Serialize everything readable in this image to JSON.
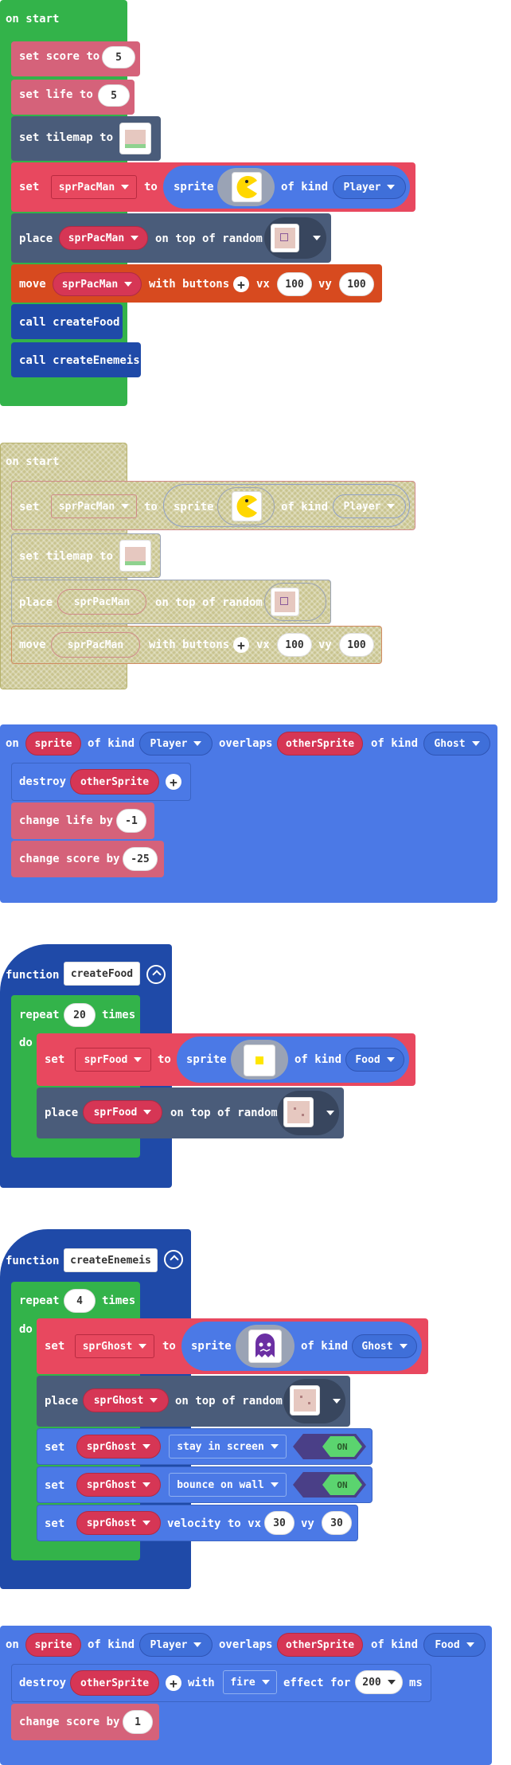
{
  "colors": {
    "events": "#33b34a",
    "sprites": "#4b79e6",
    "setvar": "#e8485f",
    "info": "#d5627a",
    "scene": "#4a5c7a",
    "controller": "#d74a1f",
    "functions": "#1f4aa8",
    "disabled": "#c9c48f",
    "toggle_on": "#5bd46f"
  },
  "block1": {
    "event": "on start",
    "set": "set",
    "to": "to",
    "score_var": "score",
    "score_val": "5",
    "life_var": "life",
    "life_val": "5",
    "tilemap": "set tilemap to",
    "sprite_var": "sprPacMan",
    "sprite": "sprite",
    "of_kind": "of kind",
    "kind": "Player",
    "place": "place",
    "on_top": "on top of random",
    "move": "move",
    "with_buttons": "with buttons",
    "vx": "vx",
    "vy": "vy",
    "vx_val": "100",
    "vy_val": "100",
    "call1": "call createFood",
    "call2": "call createEnemeis"
  },
  "block2": {
    "event": "on start",
    "set": "set",
    "to": "to",
    "sprite_var": "sprPacMan",
    "sprite": "sprite",
    "of_kind": "of kind",
    "kind": "Player",
    "tilemap": "set tilemap to",
    "place": "place",
    "on_top": "on top of random",
    "move": "move",
    "with_buttons": "with buttons",
    "vx": "vx",
    "vy": "vy",
    "vx_val": "100",
    "vy_val": "100"
  },
  "block3": {
    "on": "on",
    "sprite": "sprite",
    "of_kind": "of kind",
    "kind1": "Player",
    "overlaps": "overlaps",
    "other": "otherSprite",
    "kind2": "Ghost",
    "destroy": "destroy",
    "change_life": "change life by",
    "life_val": "-1",
    "change_score": "change score by",
    "score_val": "-25"
  },
  "block4": {
    "function": "function",
    "name": "createFood",
    "repeat": "repeat",
    "times_val": "20",
    "times": "times",
    "do": "do",
    "set": "set",
    "var": "sprFood",
    "to": "to",
    "sprite": "sprite",
    "of_kind": "of kind",
    "kind": "Food",
    "place": "place",
    "on_top": "on top of random"
  },
  "block5": {
    "function": "function",
    "name": "createEnemeis",
    "repeat": "repeat",
    "times_val": "4",
    "times": "times",
    "do": "do",
    "set": "set",
    "var": "sprGhost",
    "to": "to",
    "sprite": "sprite",
    "of_kind": "of kind",
    "kind": "Ghost",
    "place": "place",
    "on_top": "on top of random",
    "flag1": "stay in screen",
    "flag2": "bounce on wall",
    "on": "ON",
    "velocity": "velocity to vx",
    "vx_val": "30",
    "vy": "vy",
    "vy_val": "30"
  },
  "block6": {
    "on": "on",
    "sprite": "sprite",
    "of_kind": "of kind",
    "kind1": "Player",
    "overlaps": "overlaps",
    "other": "otherSprite",
    "kind2": "Food",
    "destroy": "destroy",
    "with": "with",
    "effect": "fire",
    "effect_for": "effect for",
    "ms_val": "200",
    "ms": "ms",
    "change_score": "change score by",
    "score_val": "1"
  }
}
